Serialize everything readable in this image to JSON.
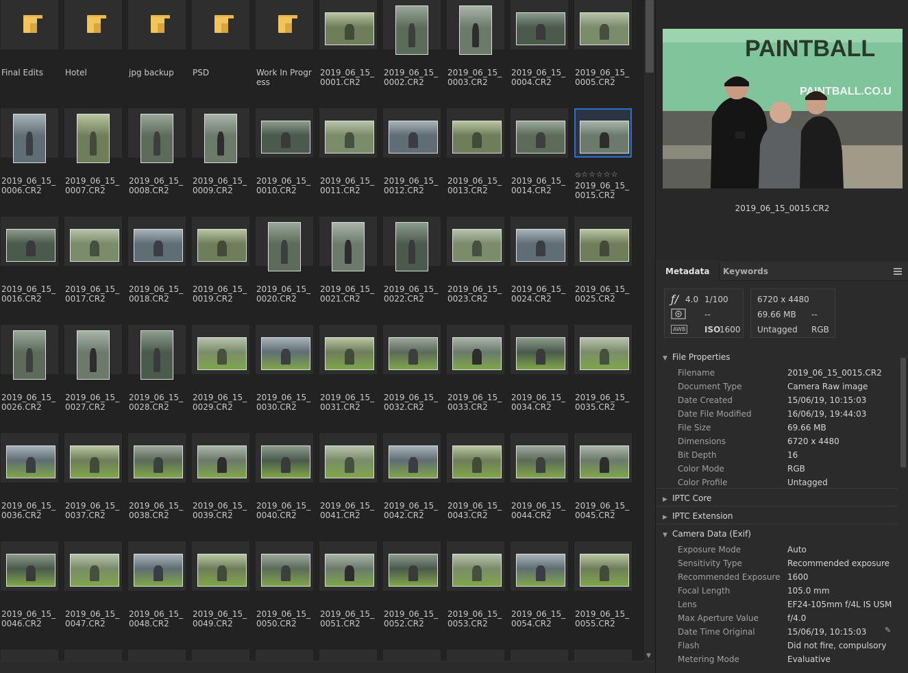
{
  "colors": {
    "folder": "#f2c55c",
    "selection": "#2d6fc4",
    "background": "#222222",
    "panel": "#2b2b2b"
  },
  "grid": {
    "tiles": [
      {
        "type": "folder",
        "label": "Final Edits"
      },
      {
        "type": "folder",
        "label": "Hotel"
      },
      {
        "type": "folder",
        "label": "jpg backup"
      },
      {
        "type": "folder",
        "label": "PSD"
      },
      {
        "type": "folder",
        "label": "Work In Progress"
      },
      {
        "type": "image",
        "label": "2019_06_15_0001.CR2",
        "orient": "land"
      },
      {
        "type": "image",
        "label": "2019_06_15_0002.CR2",
        "orient": "port"
      },
      {
        "type": "image",
        "label": "2019_06_15_0003.CR2",
        "orient": "port"
      },
      {
        "type": "image",
        "label": "2019_06_15_0004.CR2",
        "orient": "land"
      },
      {
        "type": "image",
        "label": "2019_06_15_0005.CR2",
        "orient": "land"
      },
      {
        "type": "image",
        "label": "2019_06_15_0006.CR2",
        "orient": "port"
      },
      {
        "type": "image",
        "label": "2019_06_15_0007.CR2",
        "orient": "port"
      },
      {
        "type": "image",
        "label": "2019_06_15_0008.CR2",
        "orient": "port"
      },
      {
        "type": "image",
        "label": "2019_06_15_0009.CR2",
        "orient": "port"
      },
      {
        "type": "image",
        "label": "2019_06_15_0010.CR2",
        "orient": "land"
      },
      {
        "type": "image",
        "label": "2019_06_15_0011.CR2",
        "orient": "land"
      },
      {
        "type": "image",
        "label": "2019_06_15_0012.CR2",
        "orient": "land"
      },
      {
        "type": "image",
        "label": "2019_06_15_0013.CR2",
        "orient": "land"
      },
      {
        "type": "image",
        "label": "2019_06_15_0014.CR2",
        "orient": "land"
      },
      {
        "type": "image",
        "label": "2019_06_15_0015.CR2",
        "orient": "land",
        "selected": true,
        "rating": "⦸☆☆☆☆☆"
      },
      {
        "type": "image",
        "label": "2019_06_15_0016.CR2",
        "orient": "land"
      },
      {
        "type": "image",
        "label": "2019_06_15_0017.CR2",
        "orient": "land"
      },
      {
        "type": "image",
        "label": "2019_06_15_0018.CR2",
        "orient": "land"
      },
      {
        "type": "image",
        "label": "2019_06_15_0019.CR2",
        "orient": "land"
      },
      {
        "type": "image",
        "label": "2019_06_15_0020.CR2",
        "orient": "port"
      },
      {
        "type": "image",
        "label": "2019_06_15_0021.CR2",
        "orient": "port"
      },
      {
        "type": "image",
        "label": "2019_06_15_0022.CR2",
        "orient": "port"
      },
      {
        "type": "image",
        "label": "2019_06_15_0023.CR2",
        "orient": "land"
      },
      {
        "type": "image",
        "label": "2019_06_15_0024.CR2",
        "orient": "land"
      },
      {
        "type": "image",
        "label": "2019_06_15_0025.CR2",
        "orient": "land"
      },
      {
        "type": "image",
        "label": "2019_06_15_0026.CR2",
        "orient": "port"
      },
      {
        "type": "image",
        "label": "2019_06_15_0027.CR2",
        "orient": "port"
      },
      {
        "type": "image",
        "label": "2019_06_15_0028.CR2",
        "orient": "port"
      },
      {
        "type": "image",
        "label": "2019_06_15_0029.CR2",
        "orient": "land"
      },
      {
        "type": "image",
        "label": "2019_06_15_0030.CR2",
        "orient": "land"
      },
      {
        "type": "image",
        "label": "2019_06_15_0031.CR2",
        "orient": "land"
      },
      {
        "type": "image",
        "label": "2019_06_15_0032.CR2",
        "orient": "land"
      },
      {
        "type": "image",
        "label": "2019_06_15_0033.CR2",
        "orient": "land"
      },
      {
        "type": "image",
        "label": "2019_06_15_0034.CR2",
        "orient": "land"
      },
      {
        "type": "image",
        "label": "2019_06_15_0035.CR2",
        "orient": "land"
      },
      {
        "type": "image",
        "label": "2019_06_15_0036.CR2",
        "orient": "land"
      },
      {
        "type": "image",
        "label": "2019_06_15_0037.CR2",
        "orient": "land"
      },
      {
        "type": "image",
        "label": "2019_06_15_0038.CR2",
        "orient": "land"
      },
      {
        "type": "image",
        "label": "2019_06_15_0039.CR2",
        "orient": "land"
      },
      {
        "type": "image",
        "label": "2019_06_15_0040.CR2",
        "orient": "land"
      },
      {
        "type": "image",
        "label": "2019_06_15_0041.CR2",
        "orient": "land"
      },
      {
        "type": "image",
        "label": "2019_06_15_0042.CR2",
        "orient": "land"
      },
      {
        "type": "image",
        "label": "2019_06_15_0043.CR2",
        "orient": "land"
      },
      {
        "type": "image",
        "label": "2019_06_15_0044.CR2",
        "orient": "land"
      },
      {
        "type": "image",
        "label": "2019_06_15_0045.CR2",
        "orient": "land"
      },
      {
        "type": "image",
        "label": "2019_06_15_0046.CR2",
        "orient": "land"
      },
      {
        "type": "image",
        "label": "2019_06_15_0047.CR2",
        "orient": "land"
      },
      {
        "type": "image",
        "label": "2019_06_15_0048.CR2",
        "orient": "land"
      },
      {
        "type": "image",
        "label": "2019_06_15_0049.CR2",
        "orient": "land"
      },
      {
        "type": "image",
        "label": "2019_06_15_0050.CR2",
        "orient": "land"
      },
      {
        "type": "image",
        "label": "2019_06_15_0051.CR2",
        "orient": "land"
      },
      {
        "type": "image",
        "label": "2019_06_15_0052.CR2",
        "orient": "land"
      },
      {
        "type": "image",
        "label": "2019_06_15_0053.CR2",
        "orient": "land"
      },
      {
        "type": "image",
        "label": "2019_06_15_0054.CR2",
        "orient": "land"
      },
      {
        "type": "image",
        "label": "2019_06_15_0055.CR2",
        "orient": "land"
      },
      {
        "type": "image",
        "label": "",
        "orient": "land"
      },
      {
        "type": "image",
        "label": "",
        "orient": "land"
      },
      {
        "type": "image",
        "label": "",
        "orient": "land"
      },
      {
        "type": "image",
        "label": "",
        "orient": "land"
      },
      {
        "type": "image",
        "label": "",
        "orient": "land"
      },
      {
        "type": "image",
        "label": "",
        "orient": "land"
      },
      {
        "type": "image",
        "label": "",
        "orient": "land"
      },
      {
        "type": "image",
        "label": "",
        "orient": "land"
      },
      {
        "type": "image",
        "label": "",
        "orient": "land"
      },
      {
        "type": "image",
        "label": "",
        "orient": "land"
      }
    ]
  },
  "preview": {
    "filename": "2019_06_15_0015.CR2",
    "sign_text": "PAINTBALL",
    "sign_sub": "PAINTBALL.CO.U"
  },
  "panel": {
    "tabs": [
      {
        "label": "Metadata"
      },
      {
        "label": "Keywords"
      }
    ],
    "summary": {
      "aperture_icon": "ƒ/",
      "aperture": "4.0",
      "shutter": "1/100",
      "meter_dash": "--",
      "wb": "AWB",
      "iso_label": "ISO",
      "iso": "1600",
      "dimensions": "6720 x 4480",
      "size": "69.66 MB",
      "size_dash": "--",
      "label": "Untagged",
      "mode": "RGB"
    },
    "sections": {
      "file_properties": "File Properties",
      "iptc_core": "IPTC Core",
      "iptc_extension": "IPTC Extension",
      "camera_data": "Camera Data (Exif)"
    },
    "file_rows": [
      {
        "k": "Filename",
        "v": "2019_06_15_0015.CR2"
      },
      {
        "k": "Document Type",
        "v": "Camera Raw image"
      },
      {
        "k": "Date Created",
        "v": "15/06/19, 10:15:03"
      },
      {
        "k": "Date File Modified",
        "v": "16/06/19, 19:44:03"
      },
      {
        "k": "File Size",
        "v": "69.66 MB"
      },
      {
        "k": "Dimensions",
        "v": "6720 x 4480"
      },
      {
        "k": "Bit Depth",
        "v": "16"
      },
      {
        "k": "Color Mode",
        "v": "RGB"
      },
      {
        "k": "Color Profile",
        "v": "Untagged"
      }
    ],
    "exif_rows": [
      {
        "k": "Exposure Mode",
        "v": "Auto"
      },
      {
        "k": "Sensitivity Type",
        "v": "Recommended exposure"
      },
      {
        "k": "Recommended Exposure",
        "v": "1600"
      },
      {
        "k": "Focal Length",
        "v": "105.0 mm"
      },
      {
        "k": "Lens",
        "v": "EF24-105mm f/4L IS USM"
      },
      {
        "k": "Max Aperture Value",
        "v": "f/4.0"
      },
      {
        "k": "Date Time Original",
        "v": "15/06/19, 10:15:03"
      },
      {
        "k": "Flash",
        "v": "Did not fire, compulsory"
      },
      {
        "k": "Metering Mode",
        "v": "Evaluative"
      }
    ]
  }
}
